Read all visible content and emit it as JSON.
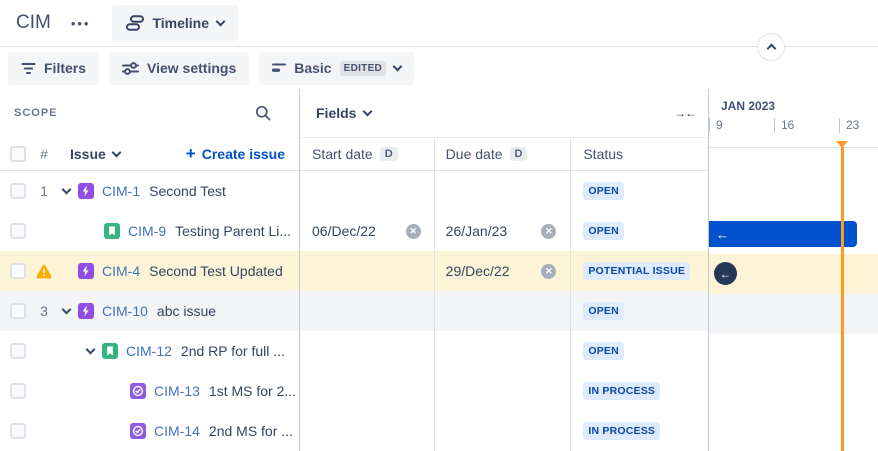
{
  "topbar": {
    "project": "CIM",
    "more": "•••",
    "view": "Timeline"
  },
  "toolbar": {
    "filters": "Filters",
    "view_settings": "View settings",
    "plan_view": "Basic",
    "edited": "EDITED"
  },
  "scope": {
    "title": "SCOPE",
    "number_col": "#",
    "issue_col": "Issue",
    "plus": "+",
    "create": "Create issue"
  },
  "fields": {
    "title": "Fields",
    "collapse_icon": "→←",
    "cols": [
      {
        "label": "Start date",
        "badge": "D"
      },
      {
        "label": "Due date",
        "badge": "D"
      },
      {
        "label": "Status"
      }
    ]
  },
  "timeline": {
    "month": "JAN 2023",
    "ticks": [
      "9",
      "16",
      "23"
    ]
  },
  "rows": [
    {
      "num": "1",
      "key": "CIM-1",
      "summary": "Second Test",
      "start": "",
      "due": "",
      "status": "OPEN"
    },
    {
      "num": "",
      "key": "CIM-9",
      "summary": "Testing Parent Li...",
      "start": "06/Dec/22",
      "due": "26/Jan/23",
      "status": "OPEN"
    },
    {
      "num": "",
      "key": "CIM-4",
      "summary": "Second Test Updated",
      "start": "",
      "due": "29/Dec/22",
      "status": "POTENTIAL ISSUE"
    },
    {
      "num": "3",
      "key": "CIM-10",
      "summary": "abc issue",
      "start": "",
      "due": "",
      "status": "OPEN"
    },
    {
      "num": "",
      "key": "CIM-12",
      "summary": "2nd RP for full ...",
      "start": "",
      "due": "",
      "status": "OPEN"
    },
    {
      "num": "",
      "key": "CIM-13",
      "summary": "1st MS for 2...",
      "start": "",
      "due": "",
      "status": "IN PROCESS"
    },
    {
      "num": "",
      "key": "CIM-14",
      "summary": "2nd MS for ...",
      "start": "",
      "due": "",
      "status": "IN PROCESS"
    }
  ],
  "colors": {
    "accent": "#0052CC",
    "bar": "#0052CC",
    "today_line": "#FF991F",
    "warning": "#FFAB00",
    "row_warning_bg": "#FDF3D6",
    "row_selected_bg": "#F3F4F6",
    "status_pill_bg": "#DEEBFF",
    "status_pill_text": "#0747A6",
    "epic_icon": "#904EE2",
    "story_icon": "#36B37E",
    "subtask_icon": "#8E5CE6"
  }
}
